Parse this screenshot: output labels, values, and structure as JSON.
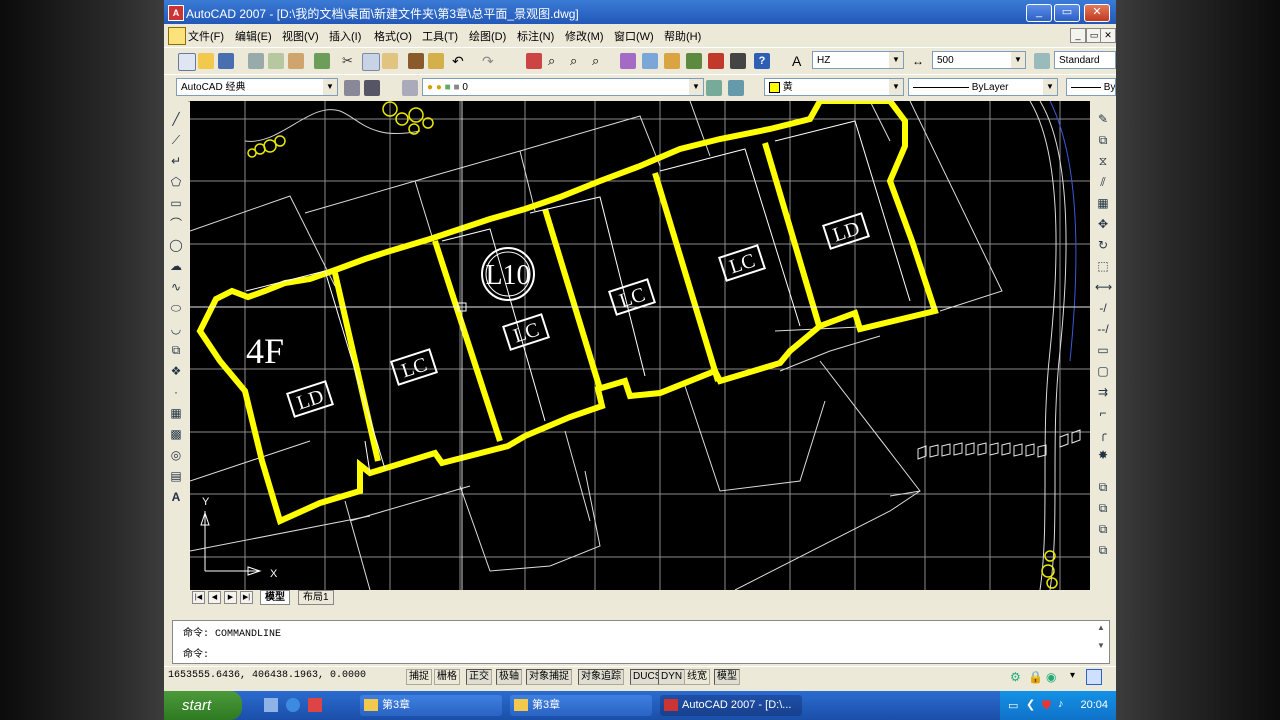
{
  "window": {
    "title": "AutoCAD 2007 - [D:\\我的文档\\桌面\\新建文件夹\\第3章\\总平面_景观图.dwg]",
    "app_icon_label": "A"
  },
  "menu": {
    "items": [
      "文件(F)",
      "编辑(E)",
      "视图(V)",
      "插入(I)",
      "格式(O)",
      "工具(T)",
      "绘图(D)",
      "标注(N)",
      "修改(M)",
      "窗口(W)",
      "帮助(H)"
    ]
  },
  "toolbar": {
    "text_style": "HZ",
    "dim_scale": "500",
    "table_style": "Standard"
  },
  "workspace": {
    "name": "AutoCAD 经典",
    "layer": "0",
    "color": "黄",
    "linetype": "ByLayer",
    "lineweight": "By"
  },
  "drawing": {
    "labels": {
      "floor": "4F",
      "l10": "L10",
      "ld1": "LD",
      "lc1": "LC",
      "lc2": "LC",
      "lc3": "LC",
      "lc4": "LC",
      "ld2": "LD"
    },
    "ucs": {
      "x": "X",
      "y": "Y"
    }
  },
  "tabs": {
    "model": "模型",
    "layout": "布局1"
  },
  "command": {
    "line1": "命令: COMMANDLINE",
    "line2": "命令:"
  },
  "status": {
    "coords": "1653555.6436, 406438.1963, 0.0000",
    "buttons": [
      "捕捉",
      "栅格",
      "正交",
      "极轴",
      "对象捕捉",
      "对象追踪",
      "DUCS",
      "DYN",
      "线宽",
      "模型"
    ]
  },
  "taskbar": {
    "start": "start",
    "tasks": [
      "第3章",
      "第3章",
      "AutoCAD 2007 - [D:\\..."
    ],
    "clock": "20:04"
  },
  "colors": {
    "outline": "#ffff00",
    "canvas": "#000000",
    "grid": "#9a9a9a"
  }
}
